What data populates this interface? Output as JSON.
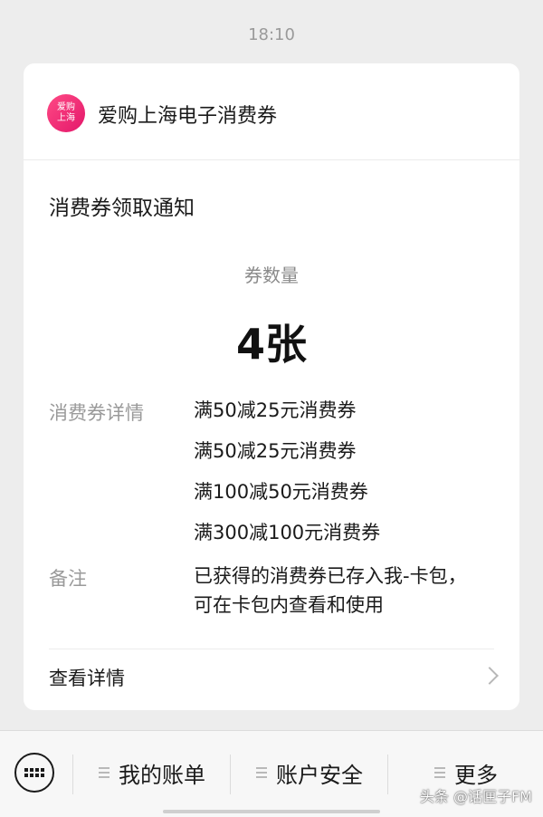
{
  "status_time": "18:10",
  "app": {
    "logo_text_line1": "爱购",
    "logo_text_line2": "上海",
    "name": "爱购上海电子消费券"
  },
  "notice": {
    "title": "消费券领取通知",
    "quantity_label": "券数量",
    "quantity_value": "4张",
    "details_label": "消费券详情",
    "details": [
      "满50减25元消费券",
      "满50减25元消费券",
      "满100减50元消费券",
      "满300减100元消费券"
    ],
    "remark_label": "备注",
    "remark_text": "已获得的消费券已存入我-卡包，可在卡包内查看和使用",
    "view_details": "查看详情"
  },
  "bottom_menu": {
    "item1": "我的账单",
    "item2": "账户安全",
    "item3": "更多"
  },
  "watermark": "头条 @话匣子FM",
  "colors": {
    "background": "#ededed",
    "card": "#ffffff",
    "brand_pink": "#e3176a",
    "muted_text": "#9a9a9a"
  },
  "icons": [
    "keyboard-icon",
    "menu-lines-icon",
    "chevron-right-icon"
  ]
}
